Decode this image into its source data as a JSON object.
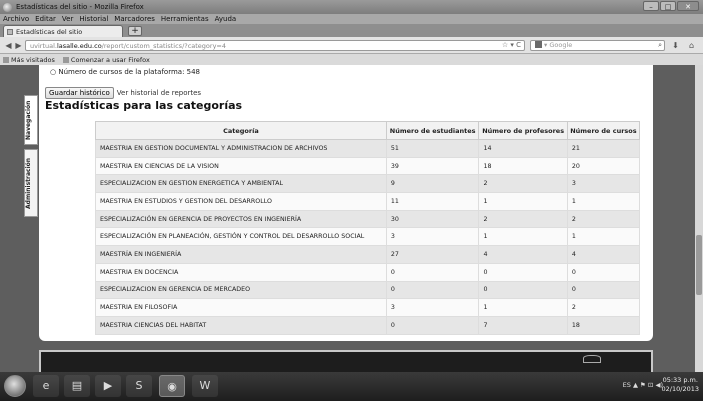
{
  "window": {
    "title": "Estadísticas del sitio - Mozilla Firefox"
  },
  "menu": [
    "Archivo",
    "Editar",
    "Ver",
    "Historial",
    "Marcadores",
    "Herramientas",
    "Ayuda"
  ],
  "tab": {
    "label": "Estadísticas del sitio",
    "new_tab": "+"
  },
  "urlbar": {
    "prefix": "uvirtual.",
    "domain": "lasalle.edu.co",
    "path": "/report/custom_statistics/?category=4"
  },
  "search": {
    "placeholder": "Google"
  },
  "bookmarks": [
    "Más visitados",
    "Comenzar a usar Firefox"
  ],
  "sidetabs": [
    "Navegación",
    "Administración"
  ],
  "page": {
    "bullet": "Número de cursos de la plataforma: 548",
    "save_button": "Guardar histórico",
    "history_link": "Ver historial de reportes",
    "heading": "Estadísticas para las categorías"
  },
  "table": {
    "headers": [
      "Categoría",
      "Número de estudiantes",
      "Número de profesores",
      "Número de cursos"
    ],
    "rows": [
      [
        "MAESTRIA EN GESTION DOCUMENTAL Y ADMINISTRACION DE ARCHIVOS",
        "51",
        "14",
        "21"
      ],
      [
        "MAESTRIA EN CIENCIAS DE LA VISION",
        "39",
        "18",
        "20"
      ],
      [
        "ESPECIALIZACION EN GESTION ENERGETICA Y AMBIENTAL",
        "9",
        "2",
        "3"
      ],
      [
        "MAESTRIA EN ESTUDIOS Y GESTION DEL DESARROLLO",
        "11",
        "1",
        "1"
      ],
      [
        "ESPECIALIZACIÓN EN GERENCIA DE PROYECTOS EN INGENIERÍA",
        "30",
        "2",
        "2"
      ],
      [
        "ESPECIALIZACIÓN EN PLANEACIÓN, GESTIÓN Y CONTROL DEL DESARROLLO SOCIAL",
        "3",
        "1",
        "1"
      ],
      [
        "MAESTRÍA EN INGENIERÍA",
        "27",
        "4",
        "4"
      ],
      [
        "MAESTRIA EN DOCENCIA",
        "0",
        "0",
        "0"
      ],
      [
        "ESPECIALIZACION EN GERENCIA DE MERCADEO",
        "0",
        "0",
        "0"
      ],
      [
        "MAESTRIA EN FILOSOFIA",
        "3",
        "1",
        "2"
      ],
      [
        "MAESTRIA CIENCIAS DEL HABITAT",
        "0",
        "7",
        "18"
      ]
    ]
  },
  "taskbar": {
    "lang": "ES",
    "time": "05:33 p.m.",
    "date": "02/10/2013"
  }
}
